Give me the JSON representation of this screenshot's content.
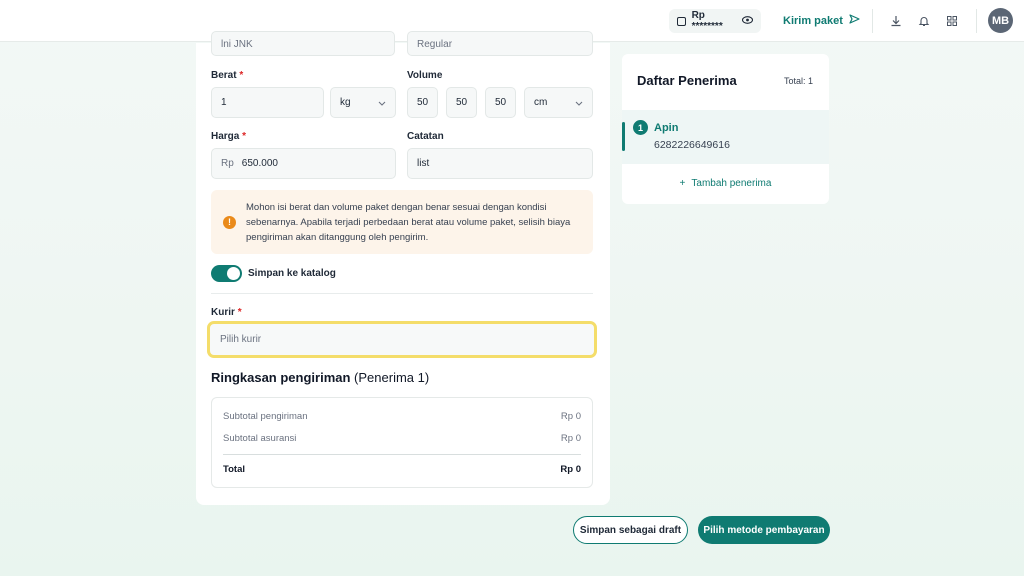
{
  "header": {
    "balance_label": "Rp ********",
    "send_link": "Kirim paket",
    "avatar_initials": "MB",
    "icons": [
      "wallet-icon",
      "eye-icon",
      "send-icon",
      "download-icon",
      "bell-icon",
      "grid-icon"
    ]
  },
  "form": {
    "top_left_value": "lni JNK",
    "top_right_value": "Regular",
    "weight": {
      "label": "Berat",
      "value": "1",
      "unit": "kg"
    },
    "volume": {
      "label": "Volume",
      "length": "50",
      "width": "50",
      "height": "50",
      "unit": "cm"
    },
    "price": {
      "label": "Harga",
      "prefix": "Rp",
      "value": "650.000"
    },
    "note": {
      "label": "Catatan",
      "value": "list"
    },
    "required_mark": "*",
    "alert": {
      "icon": "!",
      "text": "Mohon isi berat dan volume paket dengan benar sesuai dengan kondisi sebenarnya. Apabila terjadi perbedaan berat atau volume paket, selisih biaya pengiriman akan ditanggung oleh pengirim."
    },
    "save_to_catalog": {
      "label": "Simpan ke katalog",
      "checked": true
    },
    "courier": {
      "label": "Kurir",
      "placeholder": "Pilih kurir"
    }
  },
  "summary": {
    "title_bold": "Ringkasan pengiriman",
    "title_suffix": "(Penerima 1)",
    "rows": [
      {
        "label": "Subtotal pengiriman",
        "value": "Rp 0"
      },
      {
        "label": "Subtotal asuransi",
        "value": "Rp 0"
      }
    ],
    "total": {
      "label": "Total",
      "value": "Rp 0"
    }
  },
  "recipients": {
    "title": "Daftar Penerima",
    "total": "Total: 1",
    "items": [
      {
        "index": "1",
        "name": "Apin",
        "phone": "6282226649616"
      }
    ],
    "add_label": "Tambah penerima"
  },
  "actions": {
    "save_draft": "Simpan sebagai draft",
    "choose_payment": "Pilih metode pembayaran"
  },
  "colors": {
    "accent": "#0f7b72",
    "highlight_border": "#f4dd6a",
    "warning": "#ea8a1a",
    "alert_bg": "#fdf4ea",
    "required": "#dc2626"
  }
}
